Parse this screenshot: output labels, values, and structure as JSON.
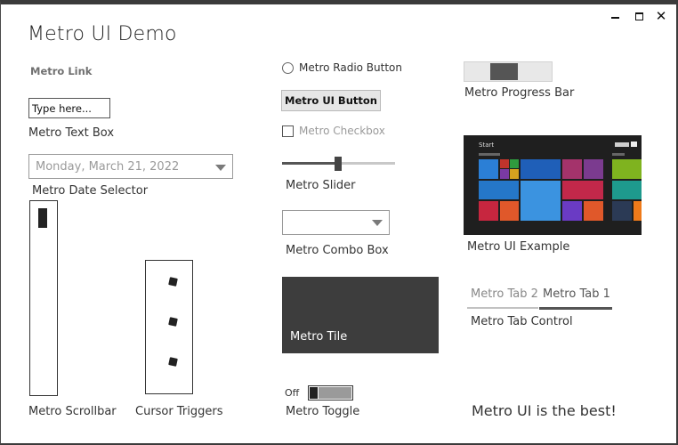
{
  "window": {
    "title": "Metro UI Demo",
    "controls": {
      "minimize": "minimize",
      "maximize": "maximize",
      "close": "✕"
    }
  },
  "link": {
    "label": "Metro Link"
  },
  "text_box": {
    "value": "Type here...",
    "label": "Metro Text Box"
  },
  "date_selector": {
    "value": "Monday, March 21, 2022",
    "label": "Metro Date Selector"
  },
  "scrollbar": {
    "label": "Metro Scrollbar",
    "thumb_position": 0.0
  },
  "cursor_triggers": {
    "label": "Cursor Triggers"
  },
  "radio": {
    "label": "Metro Radio Button",
    "checked": false
  },
  "button": {
    "label": "Metro UI Button"
  },
  "checkbox": {
    "label": "Metro Checkbox",
    "checked": false,
    "enabled": false
  },
  "slider": {
    "label": "Metro Slider",
    "value": 0.5
  },
  "combo_box": {
    "label": "Metro Combo Box",
    "value": ""
  },
  "tile": {
    "label": "Metro Tile",
    "color": "#3d3d3d"
  },
  "toggle": {
    "state": "Off",
    "label": "Metro Toggle"
  },
  "progress_bar": {
    "label": "Metro Progress Bar"
  },
  "example_image": {
    "label": "Metro UI Example",
    "start_text": "Start"
  },
  "tab_control": {
    "tabs": [
      {
        "label": "Metro Tab 2",
        "selected": false
      },
      {
        "label": "Metro Tab 1",
        "selected": true
      }
    ],
    "label": "Metro Tab Control"
  },
  "footer_text": "Metro UI is the best!",
  "colors": {
    "window_border": "#3b3b3b",
    "tile": "#3d3d3d",
    "accent_dark": "#555555",
    "muted_text": "#9a9a9a"
  }
}
